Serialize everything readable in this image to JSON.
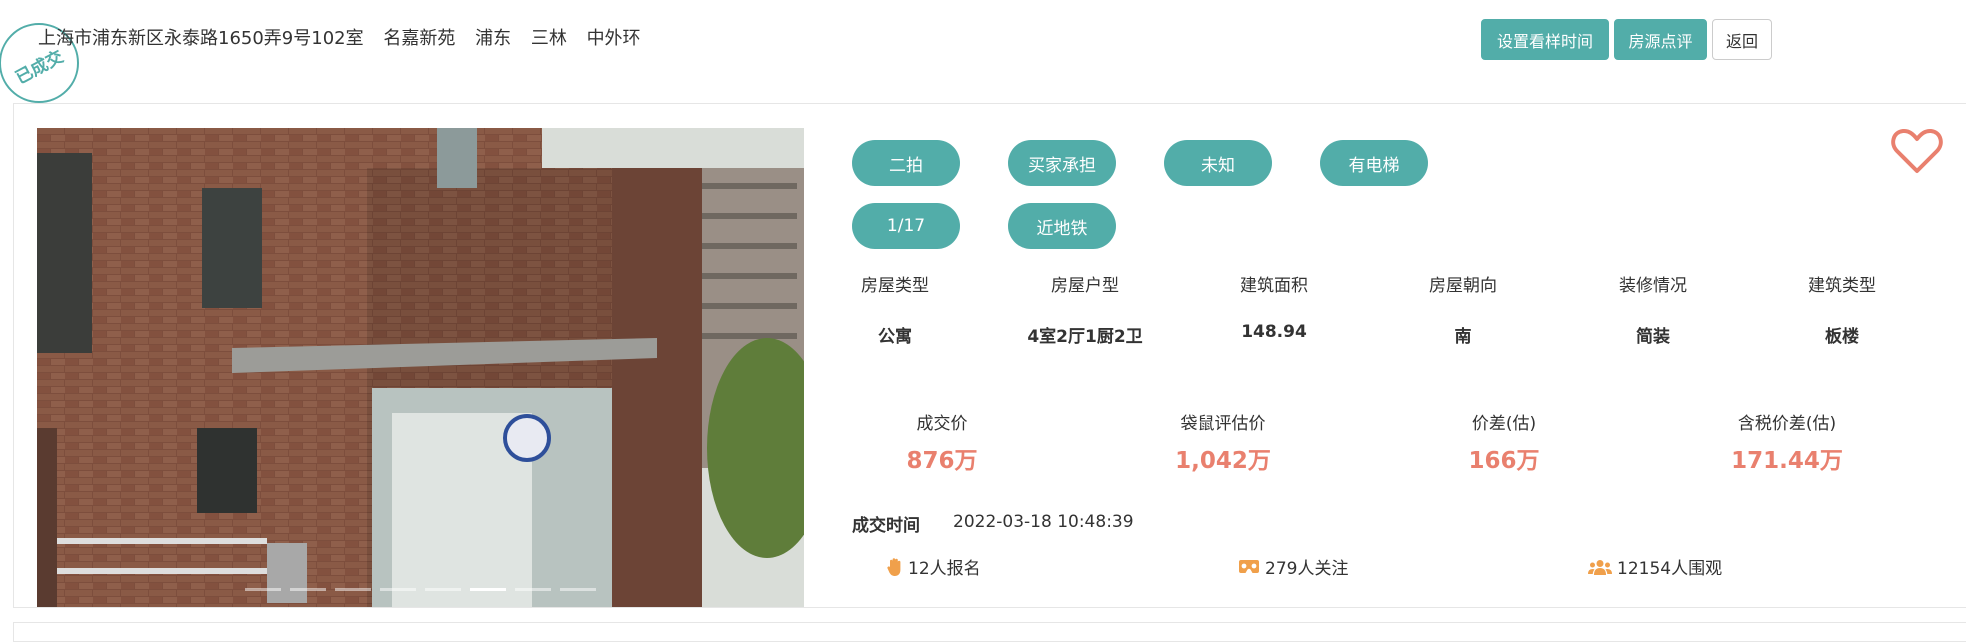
{
  "header": {
    "address": "上海市浦东新区永泰路1650弄9号102室",
    "community": "名嘉新苑",
    "district": "浦东",
    "plate": "三林",
    "ring": "中外环",
    "stamp": "已成交"
  },
  "actions": {
    "set_viewing_time": "设置看样时间",
    "property_review": "房源点评",
    "back": "返回"
  },
  "carousel": {
    "slide_count": 8,
    "active_index": 5
  },
  "tags": [
    "二拍",
    "买家承担",
    "未知",
    "有电梯",
    "1/17",
    "近地铁"
  ],
  "specs": [
    {
      "label": "房屋类型",
      "value": "公寓"
    },
    {
      "label": "房屋户型",
      "value": "4室2厅1厨2卫"
    },
    {
      "label": "建筑面积",
      "value": "148.94"
    },
    {
      "label": "房屋朝向",
      "value": "南"
    },
    {
      "label": "装修情况",
      "value": "简装"
    },
    {
      "label": "建筑类型",
      "value": "板楼"
    }
  ],
  "prices": [
    {
      "label": "成交价",
      "value": "876万"
    },
    {
      "label": "袋鼠评估价",
      "value": "1,042万"
    },
    {
      "label": "价差(估)",
      "value": "166万"
    },
    {
      "label": "含税价差(估)",
      "value": "171.44万"
    }
  ],
  "deal": {
    "label": "成交时间",
    "time": "2022-03-18 10:48:39"
  },
  "stats": {
    "signups": "12人报名",
    "followers": "279人关注",
    "viewers": "12154人围观"
  },
  "colors": {
    "accent": "#52ada9",
    "price": "#e9806e",
    "heart": "#e9806e"
  },
  "icons": [
    "hand-icon",
    "vr-glasses-icon",
    "users-icon",
    "heart-icon"
  ]
}
